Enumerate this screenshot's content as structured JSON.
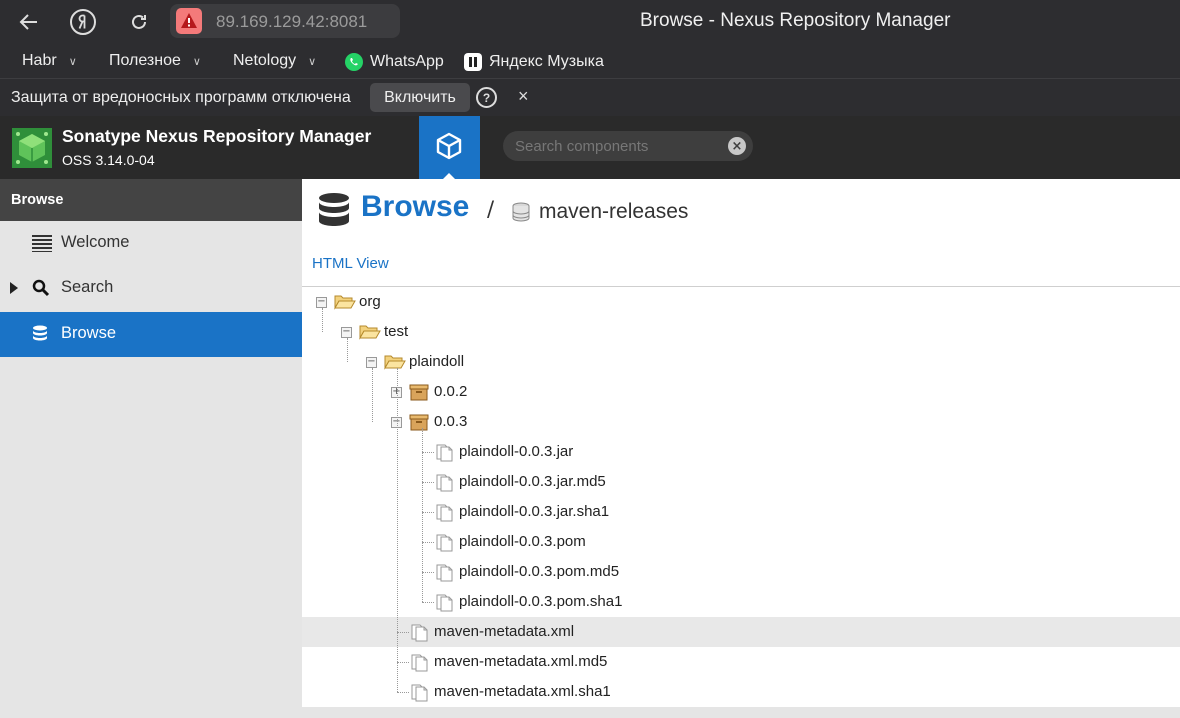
{
  "browser": {
    "address": "89.169.129.42:8081",
    "window_title": "Browse - Nexus Repository Manager"
  },
  "bookmarks": [
    {
      "label": "Habr"
    },
    {
      "label": "Полезное"
    },
    {
      "label": "Netology"
    },
    {
      "label": "WhatsApp"
    },
    {
      "label": "Яндекс Музыка"
    }
  ],
  "infobar": {
    "message": "Защита от вредоносных программ отключена",
    "enable_label": "Включить",
    "help": "?",
    "close": "×"
  },
  "app": {
    "title": "Sonatype Nexus Repository Manager",
    "version": "OSS 3.14.0-04",
    "search_placeholder": "Search components"
  },
  "sidebar": {
    "heading": "Browse",
    "items": [
      {
        "label": "Welcome",
        "icon": "list-icon"
      },
      {
        "label": "Search",
        "icon": "search-icon"
      },
      {
        "label": "Browse",
        "icon": "database-icon",
        "active": true
      }
    ]
  },
  "main": {
    "title": "Browse",
    "separator": "/",
    "repository": "maven-releases",
    "html_view": "HTML View"
  },
  "tree": [
    {
      "label": "org",
      "type": "folder-open",
      "depth": 0,
      "toggle": "minus"
    },
    {
      "label": "test",
      "type": "folder-open",
      "depth": 1,
      "toggle": "minus"
    },
    {
      "label": "plaindoll",
      "type": "folder-open",
      "depth": 2,
      "toggle": "minus"
    },
    {
      "label": "0.0.2",
      "type": "component",
      "depth": 3,
      "toggle": "plus"
    },
    {
      "label": "0.0.3",
      "type": "component",
      "depth": 3,
      "toggle": "minus"
    },
    {
      "label": "plaindoll-0.0.3.jar",
      "type": "file",
      "depth": 4
    },
    {
      "label": "plaindoll-0.0.3.jar.md5",
      "type": "file",
      "depth": 4
    },
    {
      "label": "plaindoll-0.0.3.jar.sha1",
      "type": "file",
      "depth": 4
    },
    {
      "label": "plaindoll-0.0.3.pom",
      "type": "file",
      "depth": 4
    },
    {
      "label": "plaindoll-0.0.3.pom.md5",
      "type": "file",
      "depth": 4
    },
    {
      "label": "plaindoll-0.0.3.pom.sha1",
      "type": "file",
      "depth": 4
    },
    {
      "label": "maven-metadata.xml",
      "type": "file",
      "depth": 3,
      "selected": true
    },
    {
      "label": "maven-metadata.xml.md5",
      "type": "file",
      "depth": 3
    },
    {
      "label": "maven-metadata.xml.sha1",
      "type": "file",
      "depth": 3
    }
  ]
}
